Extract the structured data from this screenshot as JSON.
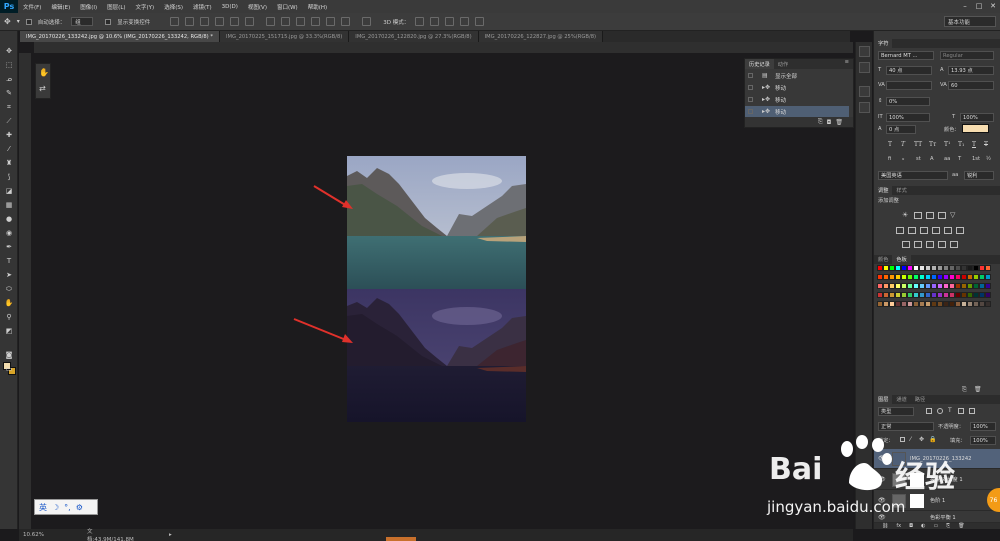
{
  "menu": {
    "logo": "Ps",
    "items": [
      "文件(F)",
      "编辑(E)",
      "图像(I)",
      "图层(L)",
      "文字(Y)",
      "选择(S)",
      "滤镜(T)",
      "3D(D)",
      "视图(V)",
      "窗口(W)",
      "帮助(H)"
    ]
  },
  "options": {
    "auto_select_label": "自动选择：",
    "auto_select_value": "组",
    "show_transform_label": "显示变换控件",
    "mode_label": "3D 模式：",
    "workspace": "基本功能"
  },
  "doc_tabs": [
    "IMG_20170226_133242.jpg @ 10.6% (IMG_20170226_133242, RGB/8) *",
    "IMG_20170225_151715.jpg @ 33.3%(RGB/8)",
    "IMG_20170226_122820.jpg @ 27.3%(RGB/8)",
    "IMG_20170226_122827.jpg @ 25%(RGB/8)"
  ],
  "history": {
    "tabs": [
      "历史记录",
      "动作"
    ],
    "items": [
      "显示全部",
      "移动",
      "移动",
      "移动"
    ]
  },
  "character": {
    "tab": "字符",
    "font_family": "Bernard MT ...",
    "font_style": "Regular",
    "size": "40 点",
    "leading": "13.93 点",
    "tracking": "60",
    "vertical_scale_pct": "0%",
    "h_scale": "100%",
    "v_scale": "100%",
    "baseline": "0 点",
    "color_label": "颜色：",
    "color_hex": "#f7ddb0",
    "lang": "美国英语",
    "aa_label": "aa",
    "aa_value": "锐利"
  },
  "adjustments": {
    "tabs": [
      "调整",
      "样式"
    ],
    "add_label": "添加调整"
  },
  "swatches": {
    "tabs": [
      "颜色",
      "色板"
    ],
    "colors": [
      "#ff0000",
      "#ffff00",
      "#00ff00",
      "#00ffff",
      "#0000ff",
      "#ff00ff",
      "#ffffff",
      "#e6e6e6",
      "#cccccc",
      "#b3b3b3",
      "#999999",
      "#808080",
      "#666666",
      "#4d4d4d",
      "#333333",
      "#1a1a1a",
      "#000000",
      "#ff3333",
      "#ff6633",
      "#ff3300",
      "#ff6600",
      "#ff9900",
      "#ffcc00",
      "#ccff00",
      "#66ff00",
      "#00ff66",
      "#00ffcc",
      "#00ccff",
      "#0066ff",
      "#3300ff",
      "#9900ff",
      "#ff00cc",
      "#ff0066",
      "#cc0000",
      "#cc6600",
      "#99cc00",
      "#00cc66",
      "#0099cc",
      "#ff6666",
      "#ff9966",
      "#ffcc66",
      "#ffff66",
      "#ccff66",
      "#66ff99",
      "#66ffff",
      "#66ccff",
      "#6699ff",
      "#9966ff",
      "#cc66ff",
      "#ff66cc",
      "#ff6699",
      "#993300",
      "#996600",
      "#669900",
      "#006633",
      "#006699",
      "#330099",
      "#cc3333",
      "#cc6633",
      "#cc9933",
      "#cccc33",
      "#99cc33",
      "#33cc66",
      "#33cccc",
      "#3399cc",
      "#3366cc",
      "#6633cc",
      "#9933cc",
      "#cc3399",
      "#cc3366",
      "#660000",
      "#663300",
      "#336600",
      "#003333",
      "#003366",
      "#330066",
      "#996633",
      "#cc9966",
      "#ffcc99",
      "#663333",
      "#996666",
      "#cc9999",
      "#8c6239",
      "#a67c52",
      "#c69c6d",
      "#603913",
      "#754c24",
      "#3c2415",
      "#42210b",
      "#8b5e3c",
      "#c7b299",
      "#998675",
      "#736357",
      "#534741",
      "#362f2d"
    ]
  },
  "layers": {
    "tabs": [
      "图层",
      "通道",
      "路径"
    ],
    "filter_label": "类型",
    "blend_mode": "正常",
    "opacity_label": "不透明度：",
    "opacity": "100%",
    "lock_label": "锁定：",
    "fill_label": "填充：",
    "fill": "100%",
    "items": [
      "IMG_20170226_133242",
      "亮度/对比度 1",
      "色阶 1",
      "色彩平衡 1"
    ]
  },
  "ime": {
    "lang": "英",
    "moon": "☽",
    "dots": "°,",
    "gear": "⚙"
  },
  "status": {
    "zoom": "10.62%",
    "doc_size": "文档:43.9M/141.8M"
  },
  "watermark": {
    "brand": "Bai",
    "brand2": "经验",
    "url": "jingyan.baidu.com"
  },
  "badge": "76"
}
